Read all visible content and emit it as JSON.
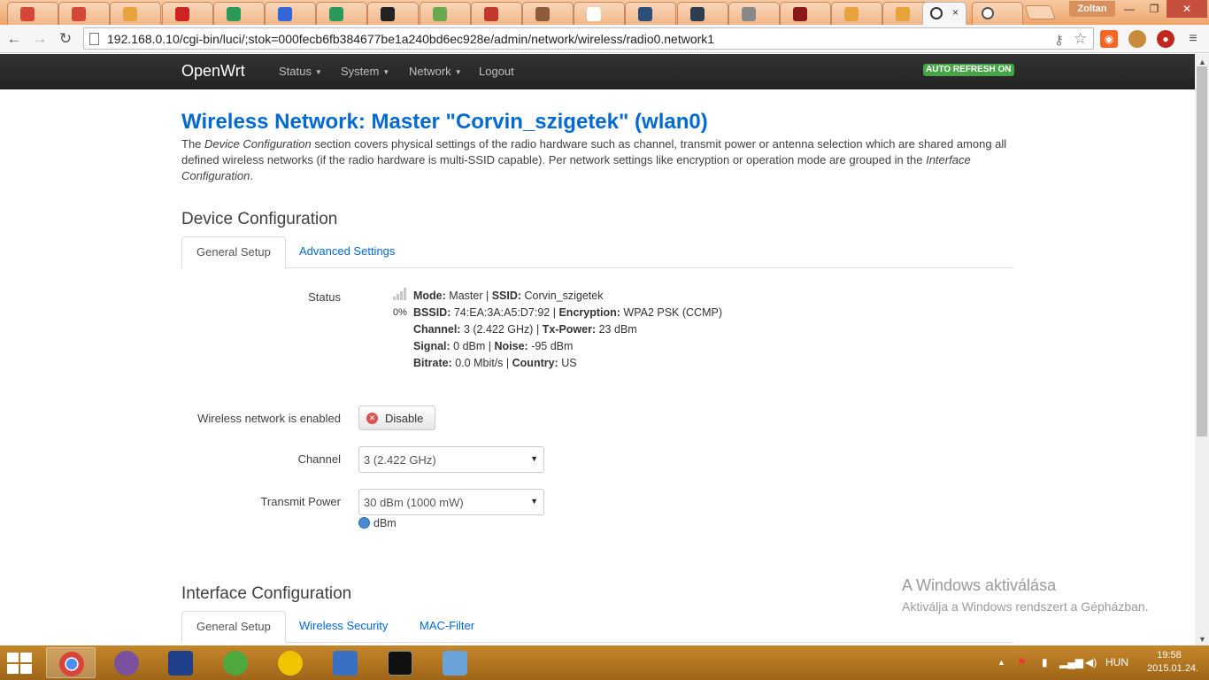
{
  "browser": {
    "active_tab_close": "×",
    "user_name": "Zoltan",
    "url": "192.168.0.10/cgi-bin/luci/;stok=000fecb6fb384677be1a240bd6ec928e/admin/network/wireless/radio0.network1",
    "window_buttons": {
      "minimize": "—",
      "maximize": "❐",
      "close": "✕"
    },
    "tab_favicon_colors": [
      "#d44638",
      "#d44638",
      "#e8a33c",
      "#cc2222",
      "#2a9a5a",
      "#3367d6",
      "#2a9a5a",
      "#222222",
      "#6aa84f",
      "#c0392b",
      "#8e5b3b",
      "#ffffff",
      "#2b4f7a",
      "#2c3e50",
      "#888888",
      "#8b1a1a",
      "#e8a33c",
      "#e8a33c"
    ]
  },
  "header": {
    "brand": "OpenWrt",
    "menu": [
      {
        "label": "Status",
        "caret": "▼"
      },
      {
        "label": "System",
        "caret": "▼"
      },
      {
        "label": "Network",
        "caret": "▼"
      },
      {
        "label": "Logout",
        "caret": ""
      }
    ],
    "auto_refresh": "AUTO REFRESH ON"
  },
  "page": {
    "title": "Wireless Network: Master \"Corvin_szigetek\" (wlan0)",
    "intro_1": "The ",
    "intro_em1": "Device Configuration",
    "intro_2": " section covers physical settings of the radio hardware such as channel, transmit power or antenna selection which are shared among all defined wireless networks (if the radio hardware is multi-SSID capable). Per network settings like encryption or operation mode are grouped in the ",
    "intro_em2": "Interface Configuration",
    "intro_3": "."
  },
  "device_config": {
    "heading": "Device Configuration",
    "tabs": [
      "General Setup",
      "Advanced Settings"
    ],
    "status_label": "Status",
    "signal_percent": "0%",
    "status": {
      "mode_k": "Mode:",
      "mode_v": "Master",
      "ssid_k": "SSID:",
      "ssid_v": "Corvin_szigetek",
      "bssid_k": "BSSID:",
      "bssid_v": "74:EA:3A:A5:D7:92",
      "enc_k": "Encryption:",
      "enc_v": "WPA2 PSK (CCMP)",
      "channel_k": "Channel:",
      "channel_v": "3 (2.422 GHz)",
      "txp_k": "Tx-Power:",
      "txp_v": "23 dBm",
      "signal_k": "Signal:",
      "signal_v": "0 dBm",
      "noise_k": "Noise:",
      "noise_v": "-95 dBm",
      "bitrate_k": "Bitrate:",
      "bitrate_v": "0.0 Mbit/s",
      "country_k": "Country:",
      "country_v": "US",
      "sep": " | "
    },
    "enabled_label": "Wireless network is enabled",
    "disable_button": "Disable",
    "channel_label": "Channel",
    "channel_value": "3 (2.422 GHz)",
    "txpower_label": "Transmit Power",
    "txpower_value": "30 dBm (1000 mW)",
    "txpower_hint": "dBm",
    "select_arrow": "▼"
  },
  "interface_config": {
    "heading": "Interface Configuration",
    "tabs": [
      "General Setup",
      "Wireless Security",
      "MAC-Filter"
    ]
  },
  "watermark": {
    "line1": "A Windows aktiválása",
    "line2": "Aktiválja a Windows rendszert a Gépházban."
  },
  "taskbar": {
    "lang": "HUN",
    "time": "19:58",
    "date": "2015.01.24.",
    "tray_arrow": "▲"
  }
}
